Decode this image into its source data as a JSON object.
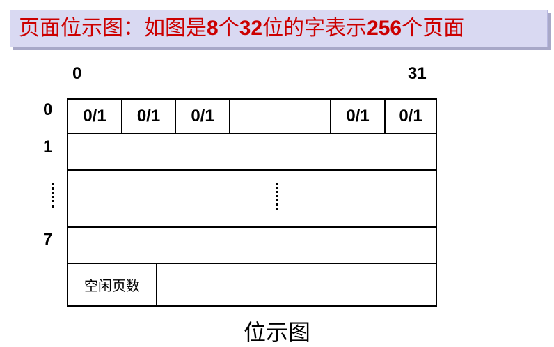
{
  "title": {
    "prefix": "页面位示图：如图是",
    "n1": "8",
    "mid1": "个",
    "n2": "32",
    "mid2": "位的字表示",
    "n3": "256",
    "suffix": "个页面"
  },
  "column_labels": {
    "first": "0",
    "last": "31"
  },
  "row_labels": {
    "r0": "0",
    "r1": "1",
    "r7": "7"
  },
  "bit_cells": [
    "0/1",
    "0/1",
    "0/1",
    "0/1",
    "0/1"
  ],
  "free_pages_label": "空闲页数",
  "caption": "位示图",
  "colors": {
    "title_bg": "#d9d9f2",
    "title_text": "#cc0000"
  }
}
